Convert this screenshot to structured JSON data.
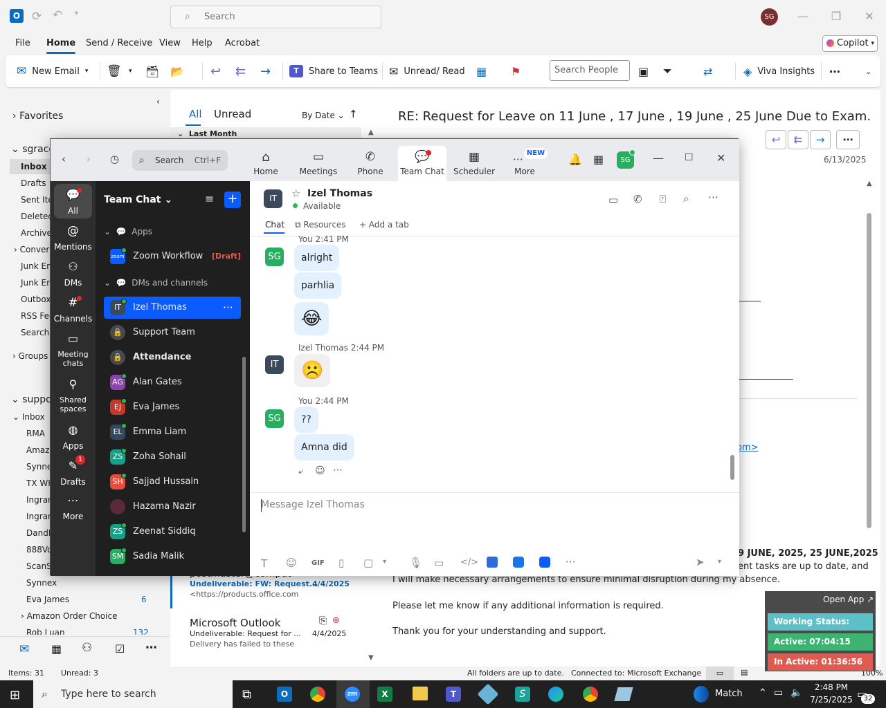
{
  "outlook": {
    "search_placeholder": "Search",
    "user_initials": "SG",
    "ribbon_tabs": [
      "File",
      "Home",
      "Send / Receive",
      "View",
      "Help",
      "Acrobat"
    ],
    "copilot_label": "Copilot",
    "toolbar": {
      "new_email": "New Email",
      "share_to_teams": "Share to Teams",
      "unread_read": "Unread/ Read",
      "search_people_placeholder": "Search People",
      "viva_insights": "Viva Insights"
    },
    "folders": {
      "favorites": "Favorites",
      "account1": "sgrace",
      "inbox": "Inbox",
      "drafts": "Drafts",
      "sent": "Sent Iter",
      "deleted": "Deleted",
      "archive": "Archive",
      "conversation": "Convers",
      "junk1": "Junk Em",
      "junk2": "Junk Em",
      "outbox": "Outbox",
      "rss": "RSS Feed",
      "search": "Search F",
      "groups": "Groups",
      "account2": "suppo",
      "inbox2": "Inbox",
      "sub": [
        "RMA",
        "Amazo",
        "Synnex",
        "TX WH",
        "Ingram",
        "Ingram",
        "DandH",
        "888Voi",
        "ScanSo",
        "Synnex"
      ],
      "eva_james": "Eva James",
      "eva_count": "6",
      "amazon_order": "Amazon Order Choice",
      "rob_luan": "Rob Luan",
      "rob_count": "132"
    },
    "msglist": {
      "tab_all": "All",
      "tab_unread": "Unread",
      "sort": "By Date",
      "group": "Last Month",
      "msg1_from": "postmaster@comput",
      "msg1_subject": "Undeliverable: FW: Request...",
      "msg1_date": "4/4/2025",
      "msg1_preview": "<https://products.office.com",
      "msg2_from": "Microsoft Outlook",
      "msg2_subject": "Undeliverable: Request for ...",
      "msg2_date": "4/4/2025",
      "msg2_preview": "Delivery has failed to these"
    },
    "reading": {
      "subject": "RE: Request for Leave on 11 June , 17 June , 19 June , 25 June  Due to Exam.",
      "date": "6/13/2025",
      "link_fragment": "om>",
      "line_dates": "9 JUNE, 2025, 25 JUNE,2025",
      "line_a": "ent tasks are up to date, and",
      "line_b": "I will make necessary arrangements to ensure minimal disruption during my absence.",
      "line_c": "Please let me know if any additional information is required.",
      "line_d": "Thank you for your understanding and support."
    },
    "status": {
      "items": "Items: 31",
      "unread": "Unread: 3",
      "folders": "All folders are up to date.",
      "connected": "Connected to: Microsoft Exchange",
      "zoom": "100%"
    }
  },
  "widget": {
    "open_app": "Open App",
    "working_status": "Working Status: Active",
    "active": "Active: 07:04:15",
    "inactive": "In Active: 01:36:56",
    "colors": {
      "status": "#5bc0c8",
      "active": "#3cb371",
      "inactive": "#e05a4f"
    }
  },
  "zoom": {
    "search_label": "Search",
    "search_shortcut": "Ctrl+F",
    "nav": [
      {
        "label": "Home"
      },
      {
        "label": "Meetings"
      },
      {
        "label": "Phone"
      },
      {
        "label": "Team Chat"
      },
      {
        "label": "Scheduler"
      },
      {
        "label": "More",
        "badge": "NEW"
      }
    ],
    "profile_initials": "SG",
    "rail": [
      "All",
      "Mentions",
      "DMs",
      "Channels",
      "Meeting chats",
      "Shared spaces",
      "Apps",
      "Drafts",
      "More"
    ],
    "drafts_badge": "1",
    "list_title": "Team Chat",
    "section_apps": "Apps",
    "section_dms": "DMs and channels",
    "zoom_workflow": "Zoom Workflow",
    "draft_tag": "[Draft]",
    "zoom_logo": "zoom",
    "contacts": [
      {
        "initials": "IT",
        "name": "Izel Thomas",
        "color": "#3a4a5c"
      },
      {
        "initials": "",
        "name": "Support Team",
        "color": "#4a4a4a"
      },
      {
        "initials": "",
        "name": "Attendance",
        "color": "#4a4a4a"
      },
      {
        "initials": "AG",
        "name": "Alan Gates",
        "color": "#8e44ad"
      },
      {
        "initials": "EJ",
        "name": "Eva James",
        "color": "#c0392b"
      },
      {
        "initials": "EL",
        "name": "Emma Liam",
        "color": "#34495e"
      },
      {
        "initials": "ZS",
        "name": "Zoha Sohail",
        "color": "#16a085"
      },
      {
        "initials": "SH",
        "name": "Sajjad Hussain",
        "color": "#e74c3c"
      },
      {
        "initials": "",
        "name": "Hazama Nazir",
        "color": "#5a2a3a"
      },
      {
        "initials": "ZS",
        "name": "Zeenat Siddiq",
        "color": "#16a085"
      },
      {
        "initials": "SM",
        "name": "Sadia Malik",
        "color": "#27ae60"
      }
    ],
    "chat": {
      "contact_name": "Izel Thomas",
      "contact_initials": "IT",
      "status": "Available",
      "tabs": [
        "Chat",
        "Resources",
        "Add a tab"
      ],
      "messages": [
        {
          "meta": "You 2:41 PM"
        },
        {
          "text": "alright"
        },
        {
          "text": "parhlia"
        },
        {
          "text": "😂"
        },
        {
          "meta": "Izel Thomas 2:44 PM"
        },
        {
          "text": "☹️"
        },
        {
          "meta": "You 2:44 PM"
        },
        {
          "text": "??"
        },
        {
          "text": "Amna did"
        }
      ],
      "my_initials": "SG",
      "input_placeholder": "Message Izel Thomas",
      "gif": "GIF"
    }
  },
  "taskbar": {
    "search_placeholder": "Type here to search",
    "weather": "Match",
    "time": "2:48 PM",
    "date": "7/25/2025",
    "notifications": "32"
  }
}
